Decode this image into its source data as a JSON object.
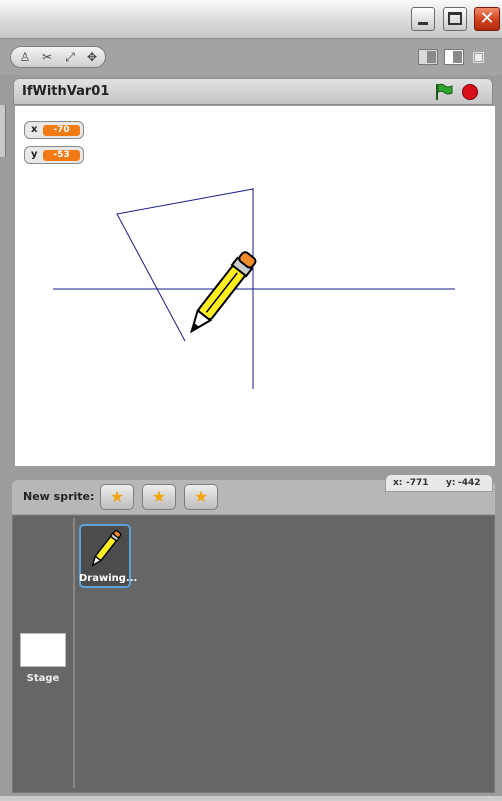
{
  "window": {
    "minimize_icon": "minimize-icon",
    "maximize_icon": "maximize-icon",
    "close_icon": "close-icon"
  },
  "toolbar": {
    "tools": [
      "duplicate-stamp-icon",
      "delete-scissors-icon",
      "grow-icon",
      "shrink-icon"
    ],
    "view_modes": [
      "small-stage-mode-icon",
      "normal-stage-mode-icon",
      "presentation-mode-icon"
    ]
  },
  "stage_header": {
    "title": "IfWithVar01",
    "green_flag_icon": "green-flag-icon",
    "stop_icon": "stop-icon"
  },
  "watchers": [
    {
      "label": "x",
      "value": "-70"
    },
    {
      "label": "y",
      "value": "-53"
    }
  ],
  "mouse_coords": {
    "x_label": "x:",
    "x_value": "-771",
    "y_label": "y:",
    "y_value": "-442"
  },
  "sprite_bar": {
    "label": "New sprite:",
    "buttons": [
      "paint-new-sprite-icon",
      "choose-sprite-from-file-icon",
      "get-surprise-sprite-icon"
    ]
  },
  "sprites": [
    {
      "name": "Drawing..."
    }
  ],
  "stage_item": {
    "label": "Stage"
  },
  "colors": {
    "watcher_value": "#f07b14",
    "drawing_line": "#1a1a8c",
    "selected_sprite_border": "#5ba2d8",
    "stop": "#d8101a",
    "flag": "#2ca82c"
  }
}
